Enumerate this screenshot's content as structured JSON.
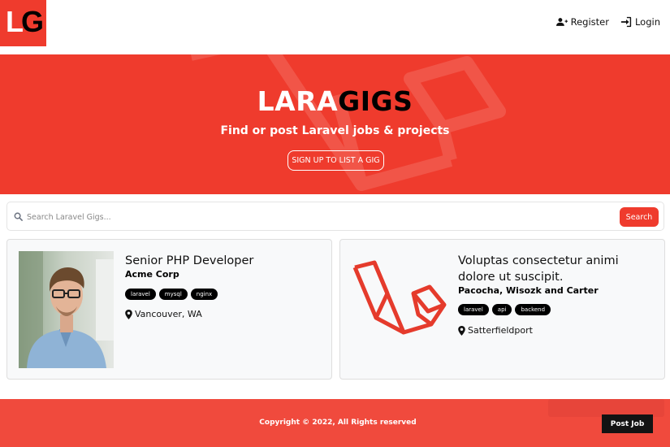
{
  "header": {
    "logo_left": "L",
    "logo_right": "G",
    "nav": {
      "register": "Register",
      "login": "Login"
    }
  },
  "hero": {
    "title_part1": "LARA",
    "title_part2": "GIGS",
    "subtitle": "Find or post Laravel jobs & projects",
    "cta": "SIGN UP TO LIST A GIG"
  },
  "search": {
    "placeholder": "Search Laravel Gigs...",
    "button": "Search"
  },
  "listings": [
    {
      "title": "Senior PHP Developer",
      "company": "Acme Corp",
      "tags": [
        "laravel",
        "mysql",
        "nginx"
      ],
      "location": "Vancouver, WA"
    },
    {
      "title": "Voluptas consectetur animi dolore ut suscipit.",
      "company": "Pacocha, Wisozk and Carter",
      "tags": [
        "laravel",
        "api",
        "backend"
      ],
      "location": "Satterfieldport"
    }
  ],
  "footer": {
    "copyright": "Copyright © 2022, All Rights reserved",
    "post_job": "Post Job"
  },
  "colors": {
    "brand_red": "#ef3b2d",
    "black": "#000000"
  }
}
